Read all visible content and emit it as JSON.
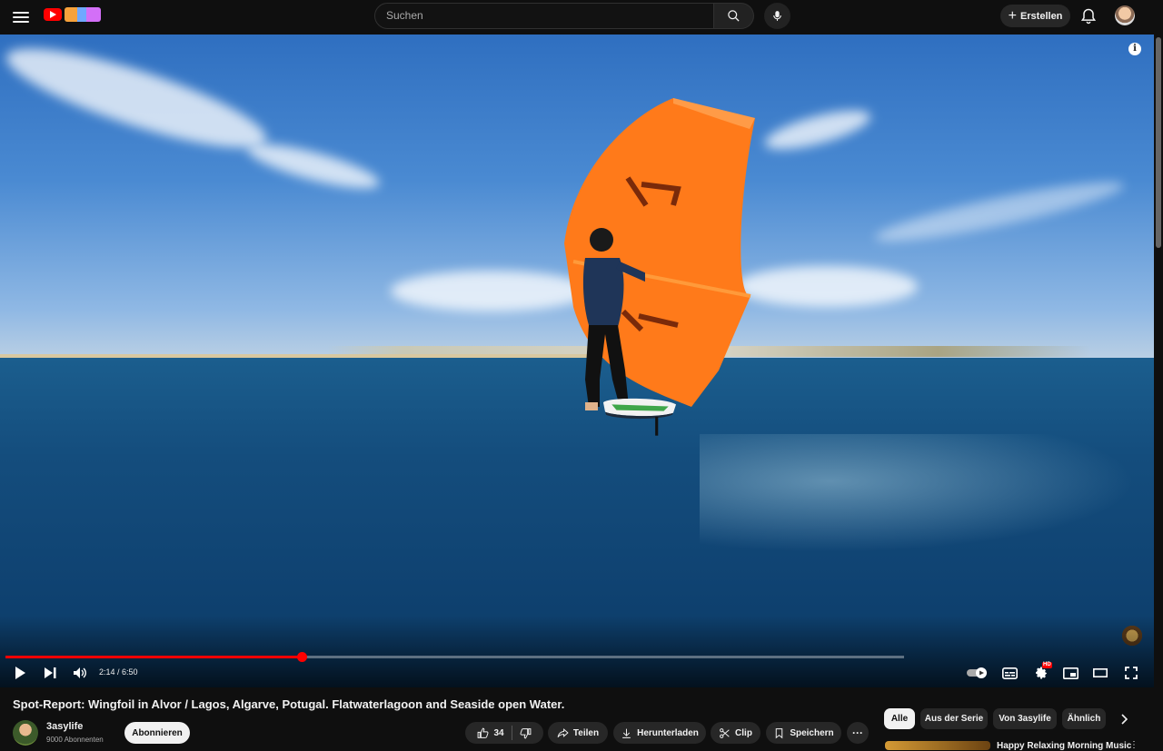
{
  "masthead": {
    "search_placeholder": "Suchen",
    "create_label": "Erstellen",
    "icons": [
      "menu-icon",
      "youtube-logo",
      "search-icon",
      "mic-icon",
      "plus-icon",
      "bell-icon",
      "avatar"
    ]
  },
  "player": {
    "time_display": "2:14 / 6:50",
    "progress_fraction": 0.33,
    "buffered_fraction": 1.0,
    "hd_badge": "HD",
    "accent_color": "#ff0000"
  },
  "video": {
    "title": "Spot-Report: Wingfoil in Alvor / Lagos, Algarve, Potugal. Flatwaterlagoon and Seaside open Water."
  },
  "channel": {
    "name": "3asylife",
    "subscribers": "9000 Abonnenten",
    "subscribe_label": "Abonnieren"
  },
  "actions": {
    "like_count": "34",
    "share_label": "Teilen",
    "download_label": "Herunterladen",
    "clip_label": "Clip",
    "save_label": "Speichern",
    "more_label": "···"
  },
  "chips": [
    {
      "label": "Alle",
      "active": true
    },
    {
      "label": "Aus der Serie",
      "active": false
    },
    {
      "label": "Von 3asylife",
      "active": false
    },
    {
      "label": "Ähnlich",
      "active": false
    }
  ],
  "recommendation": {
    "title": "Happy Relaxing Morning Music",
    "menu": "⋮"
  }
}
